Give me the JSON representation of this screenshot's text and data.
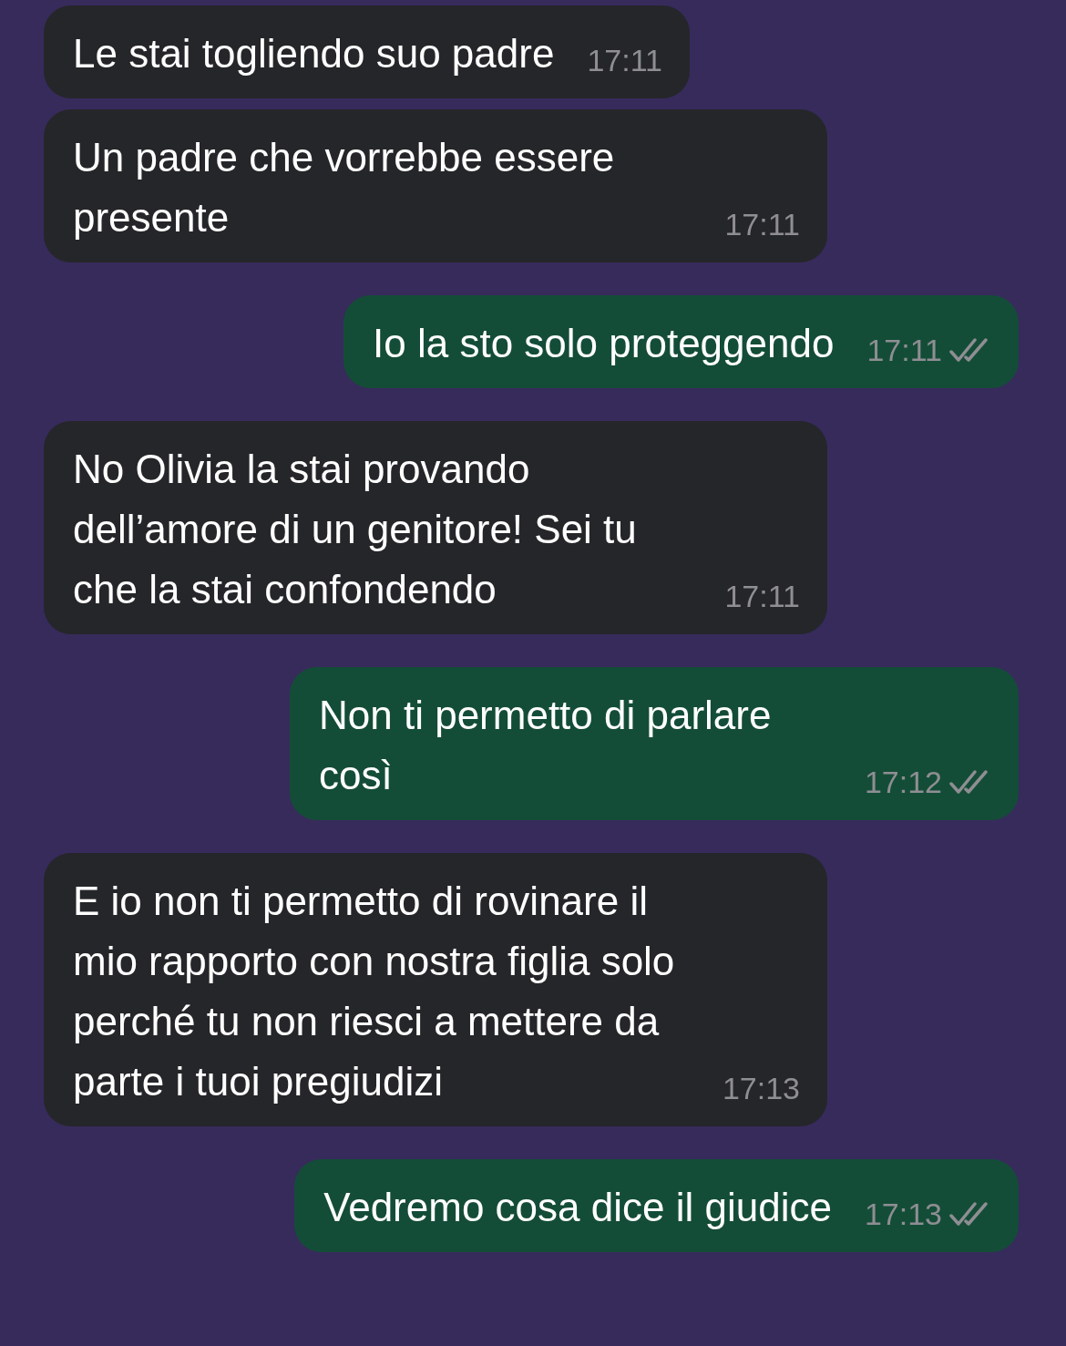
{
  "messages": [
    {
      "kind": "incoming",
      "text": "Le stai togliendo suo padre",
      "time": "17:11"
    },
    {
      "kind": "incoming",
      "text": "Un padre che vorrebbe essere presente",
      "time": "17:11"
    },
    {
      "kind": "outgoing",
      "text": "Io la sto solo proteggendo",
      "time": "17:11"
    },
    {
      "kind": "incoming",
      "text": "No Olivia la stai provando dell’amore di un genitore! Sei tu che la stai confondendo",
      "time": "17:11"
    },
    {
      "kind": "outgoing",
      "text": "Non ti permetto di parlare così",
      "time": "17:12"
    },
    {
      "kind": "incoming",
      "text": "E io non ti permetto di rovinare il mio rapporto con nostra figlia solo perché tu non riesci a mettere da parte i tuoi pregiudizi",
      "time": "17:13"
    },
    {
      "kind": "outgoing",
      "text": "Vedremo cosa dice il giudice",
      "time": "17:13"
    }
  ]
}
